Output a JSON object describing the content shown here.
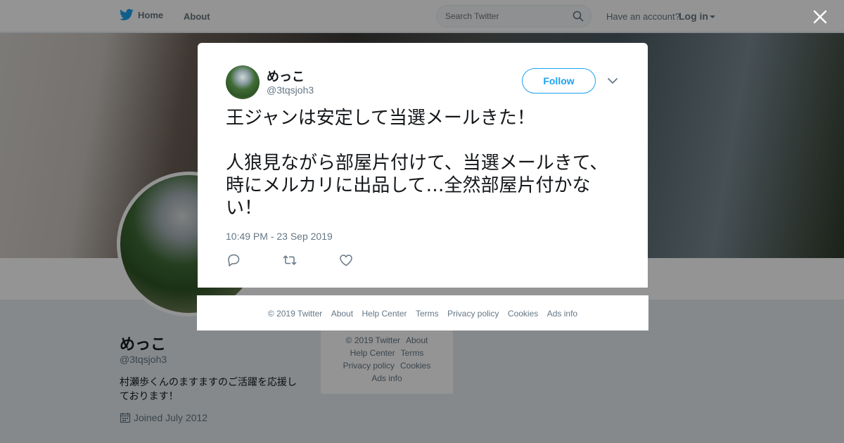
{
  "topbar": {
    "home_label": "Home",
    "about_label": "About",
    "search_placeholder": "Search Twitter",
    "have_account": "Have an account?",
    "login_label": "Log in"
  },
  "profile": {
    "name": "めっこ",
    "handle": "@3tqsjoh3",
    "bio": "村瀬歩くんのますますのご活躍を応援しております！",
    "joined": "Joined July 2012"
  },
  "side_footer": {
    "copyright": "© 2019 Twitter",
    "about": "About",
    "help": "Help Center",
    "terms": "Terms",
    "privacy": "Privacy policy",
    "cookies": "Cookies",
    "ads": "Ads info"
  },
  "tweet": {
    "author_name": "めっこ",
    "author_handle": "@3tqsjoh3",
    "follow_label": "Follow",
    "text": "王ジャンは安定して当選メールきた！\n\n人狼見ながら部屋片付けて、当選メールきて、時にメルカリに出品して…全然部屋片付かない！",
    "timestamp": "10:49 PM - 23 Sep 2019"
  },
  "modal_footer": {
    "copyright": "© 2019 Twitter",
    "about": "About",
    "help": "Help Center",
    "terms": "Terms",
    "privacy": "Privacy policy",
    "cookies": "Cookies",
    "ads": "Ads info"
  },
  "colors": {
    "brand_blue": "#1da1f2",
    "text_primary": "#14171a",
    "text_secondary": "#657786"
  },
  "icons": {
    "logo": "twitter-bird-icon",
    "search": "search-icon",
    "close": "close-icon",
    "caret": "chevron-down-icon",
    "reply": "reply-icon",
    "retweet": "retweet-icon",
    "like": "heart-icon",
    "calendar": "calendar-icon"
  }
}
